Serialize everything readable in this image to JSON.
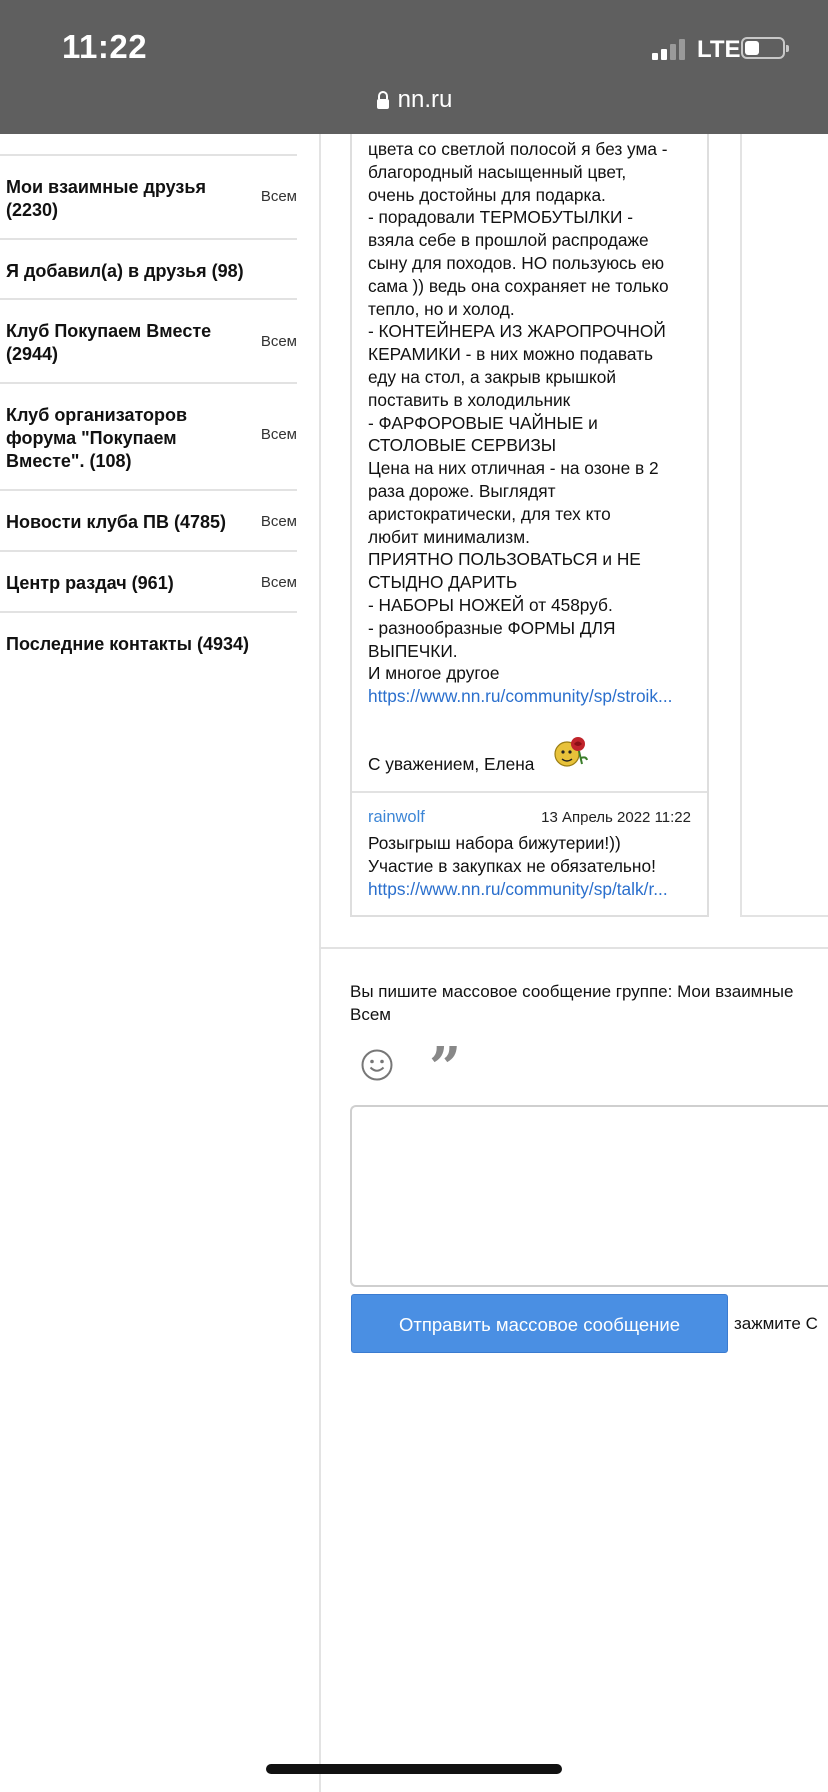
{
  "status_bar": {
    "time": "11:22",
    "network": "LTE",
    "url": "nn.ru"
  },
  "sidebar": {
    "items": [
      {
        "label": "Мои взаимные друзья (2230)",
        "action": "Всем"
      },
      {
        "label": "Я добавил(а) в друзья (98)",
        "action": ""
      },
      {
        "label": "Клуб Покупаем Вместе (2944)",
        "action": "Всем"
      },
      {
        "label": "Клуб организаторов форума \"Покупаем Вместе\". (108)",
        "action": "Всем"
      },
      {
        "label": "Новости клуба ПВ (4785)",
        "action": "Всем"
      },
      {
        "label": "Центр раздач (961)",
        "action": "Всем"
      },
      {
        "label": "Последние контакты (4934)",
        "action": ""
      }
    ]
  },
  "chat": {
    "message1": {
      "lines": [
        "цвета со светлой полосой я без ума -",
        "благородный насыщенный цвет,",
        "очень достойны для подарка.",
        "- порадовали ТЕРМОБУТЫЛКИ -",
        "взяла себе в прошлой распродаже",
        "сыну для походов. НО пользуюсь ею",
        "сама )) ведь она сохраняет не только",
        "тепло, но и холод.",
        "- КОНТЕЙНЕРА ИЗ ЖАРОПРОЧНОЙ",
        "КЕРАМИКИ - в них можно подавать",
        "еду на стол, а закрыв крышкой",
        "поставить в холодильник",
        "- ФАРФОРОВЫЕ ЧАЙНЫЕ и",
        "СТОЛОВЫЕ СЕРВИЗЫ",
        "Цена на них отличная - на озоне в 2",
        "раза дороже. Выглядят",
        "аристократически, для тех кто",
        "любит минимализм.",
        "ПРИЯТНО ПОЛЬЗОВАТЬСЯ и НЕ",
        "СТЫДНО ДАРИТЬ",
        "- НАБОРЫ НОЖЕЙ от 458руб.",
        "- разнообразные ФОРМЫ ДЛЯ",
        "ВЫПЕЧКИ.",
        "И многое другое"
      ],
      "link": "https://www.nn.ru/community/sp/stroik...",
      "signature": "С уважением, Елена"
    },
    "message2": {
      "author": "rainwolf",
      "date": "13 Апрель 2022 11:22",
      "line1": "Розыгрыш набора бижутерии!))",
      "line2": "Участие в закупках не обязательно!",
      "link": "https://www.nn.ru/community/sp/talk/r..."
    }
  },
  "compose": {
    "info_line1": "Вы пишите массовое сообщение группе: Мои взаимные",
    "info_line2": "Всем",
    "send_label": "Отправить массовое сообщение",
    "hint": "зажмите С"
  }
}
